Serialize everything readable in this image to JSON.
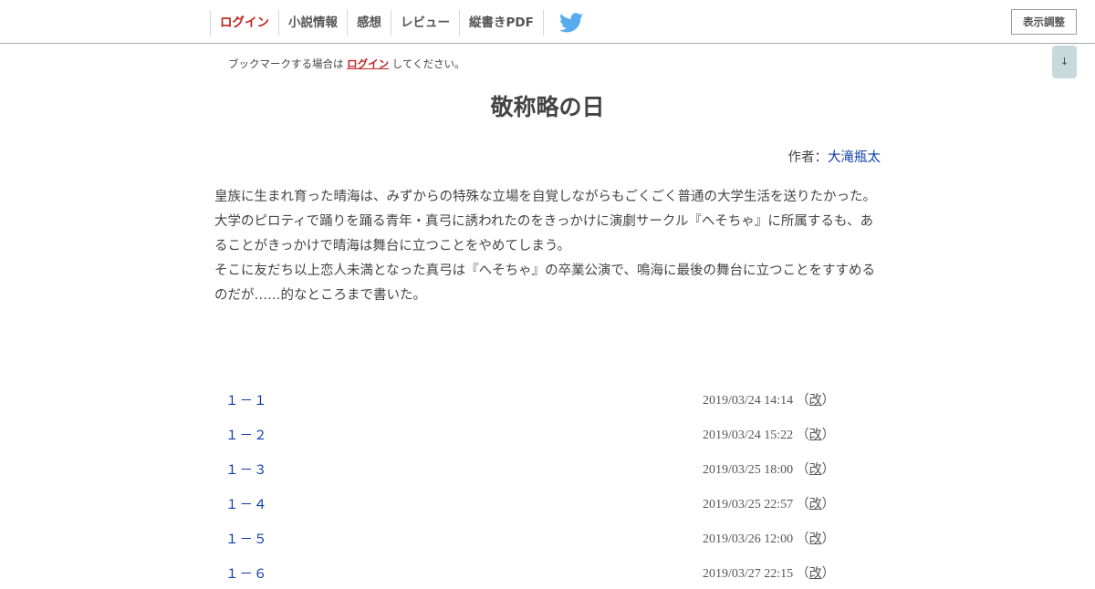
{
  "header": {
    "nav": [
      {
        "label": "ログイン",
        "name": "nav-login"
      },
      {
        "label": "小説情報",
        "name": "nav-novel-info"
      },
      {
        "label": "感想",
        "name": "nav-impressions"
      },
      {
        "label": "レビュー",
        "name": "nav-review"
      },
      {
        "label": "縦書きPDF",
        "name": "nav-vertical-pdf"
      }
    ],
    "twitter_icon": "twitter-bird-icon",
    "display_settings_label": "表示調整"
  },
  "scroll_button_label": "↓",
  "bookmark": {
    "prefix": "ブックマークする場合は ",
    "link": "ログイン",
    "suffix": " してください。"
  },
  "novel": {
    "title": "敬称略の日",
    "author_label": "作者：",
    "author_name": "大滝瓶太",
    "synopsis": [
      "皇族に生まれ育った晴海は、みずからの特殊な立場を自覚しながらもごくごく普通の大学生活を送りたかった。",
      "大学のピロティで踊りを踊る青年・真弓に誘われたのをきっかけに演劇サークル『へそちゃ』に所属するも、あることがきっかけで晴海は舞台に立つことをやめてしまう。",
      "そこに友だち以上恋人未満となった真弓は『へそちゃ』の卒業公演で、鳴海に最後の舞台に立つことをすすめるのだが……的なところまで書いた。"
    ]
  },
  "chapters": [
    {
      "title": "１－１",
      "date": "2019/03/24 14:14",
      "revised": "改"
    },
    {
      "title": "１－２",
      "date": "2019/03/24 15:22",
      "revised": "改"
    },
    {
      "title": "１－３",
      "date": "2019/03/25 18:00",
      "revised": "改"
    },
    {
      "title": "１－４",
      "date": "2019/03/25 22:57",
      "revised": "改"
    },
    {
      "title": "１－５",
      "date": "2019/03/26 12:00",
      "revised": "改"
    },
    {
      "title": "１－６",
      "date": "2019/03/27 22:15",
      "revised": "改"
    }
  ],
  "colors": {
    "login_red": "#c0211f",
    "link_blue": "#0d3da8",
    "twitter_blue": "#55acee",
    "scroll_button_bg": "#c8d9dc"
  }
}
